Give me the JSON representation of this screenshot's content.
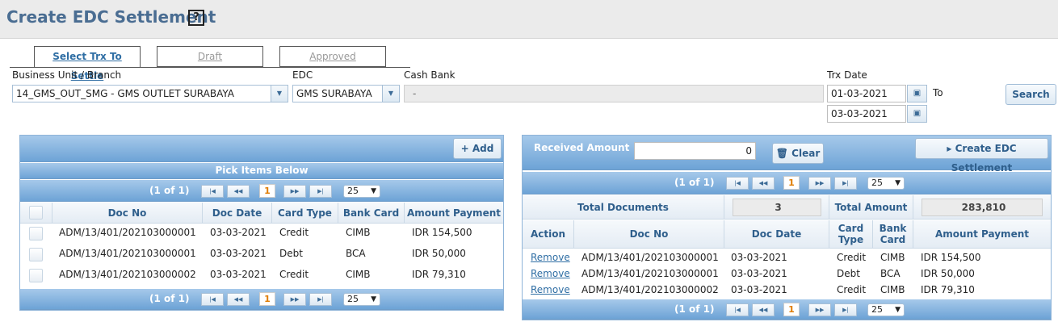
{
  "page": {
    "title": "Create EDC Settlement",
    "help_icon": "?"
  },
  "tabs": [
    {
      "label": "Select Trx To Settle",
      "active": true
    },
    {
      "label": "Draft",
      "active": false
    },
    {
      "label": "Approved",
      "active": false
    }
  ],
  "filters": {
    "business_unit_label": "Business Unit / Branch",
    "business_unit_value": "14_GMS_OUT_SMG - GMS OUTLET SURABAYA",
    "edc_label": "EDC",
    "edc_value": "GMS SURABAYA",
    "cash_bank_label": "Cash Bank",
    "cash_bank_value": "-",
    "trx_date_label": "Trx Date",
    "date_from": "01-03-2021",
    "to_label": "To",
    "date_to": "03-03-2021",
    "search_label": "Search"
  },
  "left_panel": {
    "add_label": "Add",
    "caption": "Pick Items Below",
    "pager": {
      "info": "(1 of 1)",
      "page": "1",
      "page_size": "25"
    },
    "columns": [
      "Doc No",
      "Doc Date",
      "Card Type",
      "Bank Card",
      "Amount Payment"
    ],
    "rows": [
      {
        "doc_no": "ADM/13/401/202103000001",
        "doc_date": "03-03-2021",
        "card_type": "Credit",
        "bank_card": "CIMB",
        "amount": "IDR 154,500"
      },
      {
        "doc_no": "ADM/13/401/202103000001",
        "doc_date": "03-03-2021",
        "card_type": "Debt",
        "bank_card": "BCA",
        "amount": "IDR 50,000"
      },
      {
        "doc_no": "ADM/13/401/202103000002",
        "doc_date": "03-03-2021",
        "card_type": "Credit",
        "bank_card": "CIMB",
        "amount": "IDR 79,310"
      }
    ]
  },
  "right_panel": {
    "received_amount_label": "Received Amount",
    "received_amount_value": "0",
    "clear_label": "Clear",
    "create_label": "Create EDC Settlement",
    "pager": {
      "info": "(1 of 1)",
      "page": "1",
      "page_size": "25"
    },
    "total_documents_label": "Total Documents",
    "total_documents_value": "3",
    "total_amount_label": "Total Amount",
    "total_amount_value": "283,810",
    "columns": [
      "Action",
      "Doc No",
      "Doc Date",
      "Card Type",
      "Bank Card",
      "Amount Payment"
    ],
    "rows": [
      {
        "action": "Remove",
        "doc_no": "ADM/13/401/202103000001",
        "doc_date": "03-03-2021",
        "card_type": "Credit",
        "bank_card": "CIMB",
        "amount": "IDR 154,500"
      },
      {
        "action": "Remove",
        "doc_no": "ADM/13/401/202103000001",
        "doc_date": "03-03-2021",
        "card_type": "Debt",
        "bank_card": "BCA",
        "amount": "IDR 50,000"
      },
      {
        "action": "Remove",
        "doc_no": "ADM/13/401/202103000002",
        "doc_date": "03-03-2021",
        "card_type": "Credit",
        "bank_card": "CIMB",
        "amount": "IDR 79,310"
      }
    ]
  }
}
